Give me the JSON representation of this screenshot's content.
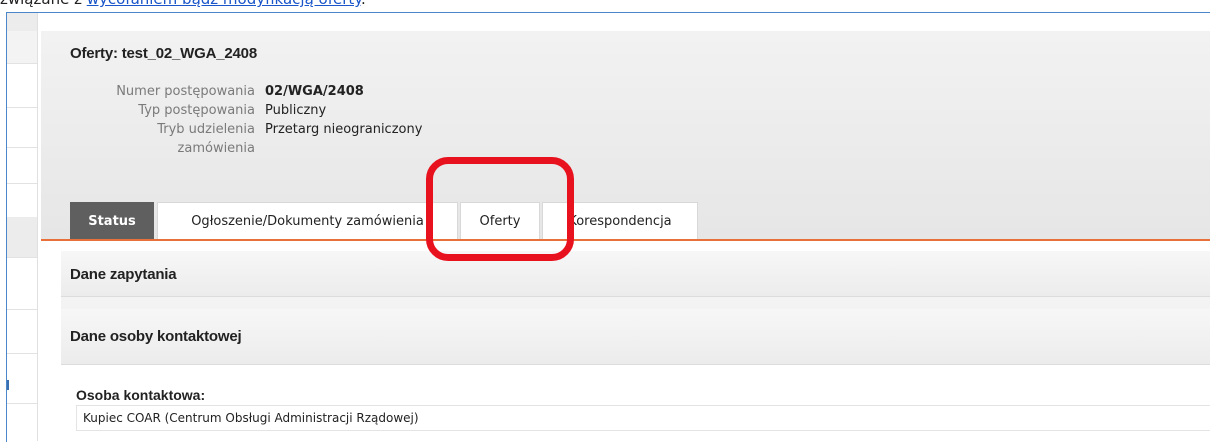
{
  "top_text": {
    "prefix": "związane z ",
    "link": "wycofaniem bądź modyfikacją oferty",
    "suffix": "."
  },
  "page": {
    "title": "Oferty: test_02_WGA_2408"
  },
  "meta": [
    {
      "label": "Numer postępowania",
      "value": "02/WGA/2408",
      "bold": true
    },
    {
      "label": "Typ postępowania",
      "value": "Publiczny",
      "bold": false
    },
    {
      "label": "Tryb udzielenia",
      "label2": "zamówienia",
      "value": "Przetarg nieograniczony",
      "bold": false
    }
  ],
  "tabs": [
    {
      "label": "Status",
      "active": true
    },
    {
      "label": "Ogłoszenie/Dokumenty zamówienia",
      "active": false
    },
    {
      "label": "Oferty",
      "active": false
    },
    {
      "label": "Korespondencja",
      "active": false
    }
  ],
  "sections": {
    "inquiry": "Dane zapytania",
    "contact": "Dane osoby kontaktowej"
  },
  "contact": {
    "label": "Osoba kontaktowa:",
    "value": "Kupiec COAR (Centrum Obsługi Administracji Rządowej)"
  },
  "colors": {
    "accent_orange": "#e8703a",
    "highlight_red": "#e8121f",
    "active_tab": "#5f5f5f",
    "link_blue": "#1a55c9"
  }
}
